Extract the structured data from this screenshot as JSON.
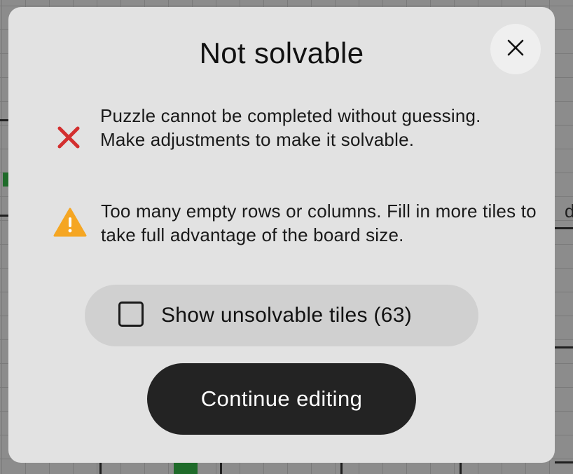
{
  "dialog": {
    "title": "Not solvable",
    "close_icon": "close-icon"
  },
  "messages": [
    {
      "icon": "error-x-icon",
      "icon_color": "#d32f2f",
      "text": "Puzzle cannot be completed without guessing. Make adjustments to make it solvable."
    },
    {
      "icon": "warning-triangle-icon",
      "icon_color": "#f5a623",
      "text": "Too many empty rows or columns. Fill in more tiles to take full advantage of the board size."
    }
  ],
  "toggle": {
    "label": "Show unsolvable tiles (63)",
    "checked": false
  },
  "primary_button": {
    "label": "Continue editing"
  },
  "background": {
    "edge_letter": "d",
    "accent_green": "#1f6b2a"
  }
}
